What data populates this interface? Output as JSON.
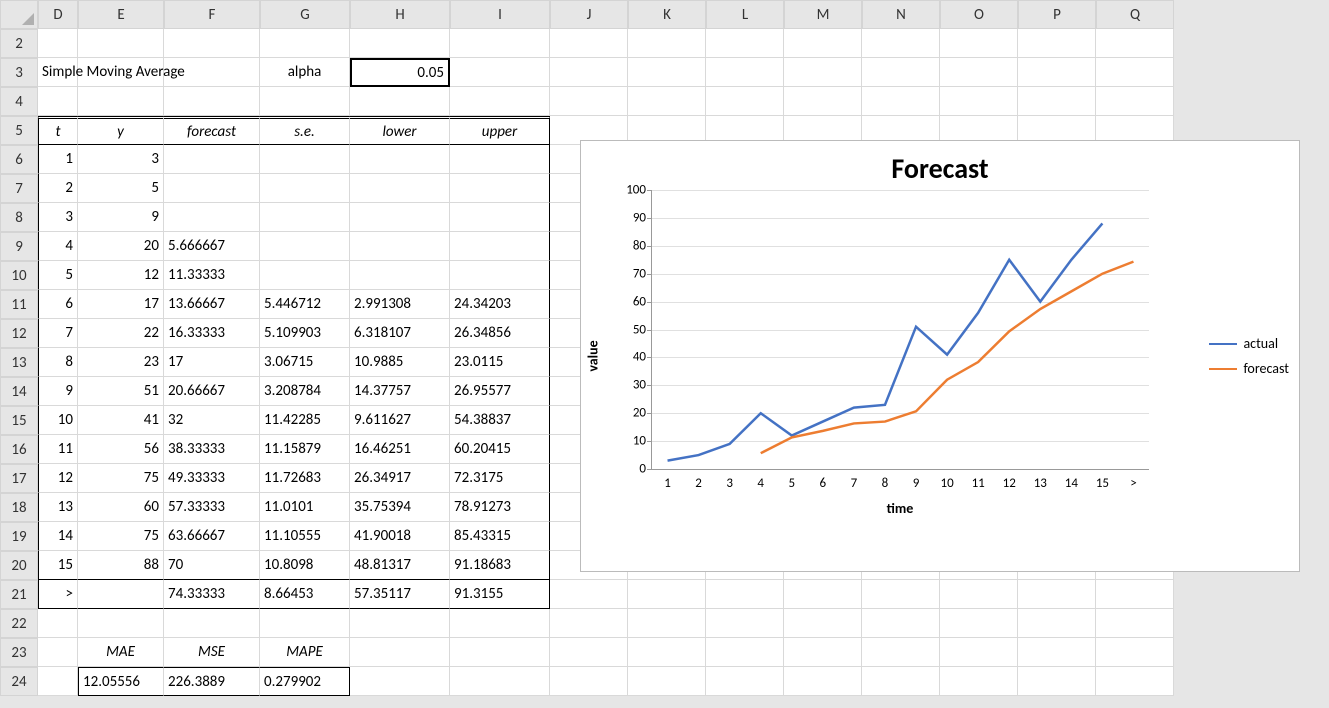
{
  "columns": [
    "D",
    "E",
    "F",
    "G",
    "H",
    "I",
    "J",
    "K",
    "L",
    "M",
    "N",
    "O",
    "P",
    "Q"
  ],
  "row_start": 2,
  "row_end": 24,
  "title_text": "Simple Moving Average",
  "alpha_label": "alpha",
  "alpha_value": "0.05",
  "headers": {
    "D": "t",
    "E": "y",
    "F": "forecast",
    "G": "s.e.",
    "H": "lower",
    "I": "upper"
  },
  "rows": [
    {
      "t": "1",
      "y": "3"
    },
    {
      "t": "2",
      "y": "5"
    },
    {
      "t": "3",
      "y": "9"
    },
    {
      "t": "4",
      "y": "20",
      "forecast": "5.666667"
    },
    {
      "t": "5",
      "y": "12",
      "forecast": "11.33333"
    },
    {
      "t": "6",
      "y": "17",
      "forecast": "13.66667",
      "se": "5.446712",
      "lower": "2.991308",
      "upper": "24.34203"
    },
    {
      "t": "7",
      "y": "22",
      "forecast": "16.33333",
      "se": "5.109903",
      "lower": "6.318107",
      "upper": "26.34856"
    },
    {
      "t": "8",
      "y": "23",
      "forecast": "17",
      "se": "3.06715",
      "lower": "10.9885",
      "upper": "23.0115"
    },
    {
      "t": "9",
      "y": "51",
      "forecast": "20.66667",
      "se": "3.208784",
      "lower": "14.37757",
      "upper": "26.95577"
    },
    {
      "t": "10",
      "y": "41",
      "forecast": "32",
      "se": "11.42285",
      "lower": "9.611627",
      "upper": "54.38837"
    },
    {
      "t": "11",
      "y": "56",
      "forecast": "38.33333",
      "se": "11.15879",
      "lower": "16.46251",
      "upper": "60.20415"
    },
    {
      "t": "12",
      "y": "75",
      "forecast": "49.33333",
      "se": "11.72683",
      "lower": "26.34917",
      "upper": "72.3175"
    },
    {
      "t": "13",
      "y": "60",
      "forecast": "57.33333",
      "se": "11.0101",
      "lower": "35.75394",
      "upper": "78.91273"
    },
    {
      "t": "14",
      "y": "75",
      "forecast": "63.66667",
      "se": "11.10555",
      "lower": "41.90018",
      "upper": "85.43315"
    },
    {
      "t": "15",
      "y": "88",
      "forecast": "70",
      "se": "10.8098",
      "lower": "48.81317",
      "upper": "91.18683"
    },
    {
      "t": ">",
      "forecast": "74.33333",
      "se": "8.66453",
      "lower": "57.35117",
      "upper": "91.3155"
    }
  ],
  "metrics_labels": {
    "E": "MAE",
    "F": "MSE",
    "G": "MAPE"
  },
  "metrics_values": {
    "E": "12.05556",
    "F": "226.3889",
    "G": "0.279902"
  },
  "chart_data": {
    "type": "line",
    "title": "Forecast",
    "xlabel": "time",
    "ylabel": "value",
    "ylim": [
      0,
      100
    ],
    "yticks": [
      0,
      10,
      20,
      30,
      40,
      50,
      60,
      70,
      80,
      90,
      100
    ],
    "categories": [
      "1",
      "2",
      "3",
      "4",
      "5",
      "6",
      "7",
      "8",
      "9",
      "10",
      "11",
      "12",
      "13",
      "14",
      "15",
      ">"
    ],
    "series": [
      {
        "name": "actual",
        "color": "#4472c4",
        "values": [
          3,
          5,
          9,
          20,
          12,
          17,
          22,
          23,
          51,
          41,
          56,
          75,
          60,
          75,
          88,
          null
        ]
      },
      {
        "name": "forecast",
        "color": "#ed7d31",
        "values": [
          null,
          null,
          null,
          5.666667,
          11.33333,
          13.66667,
          16.33333,
          17,
          20.66667,
          32,
          38.33333,
          49.33333,
          57.33333,
          63.66667,
          70,
          74.33333
        ]
      }
    ],
    "legend": [
      "actual",
      "forecast"
    ]
  }
}
